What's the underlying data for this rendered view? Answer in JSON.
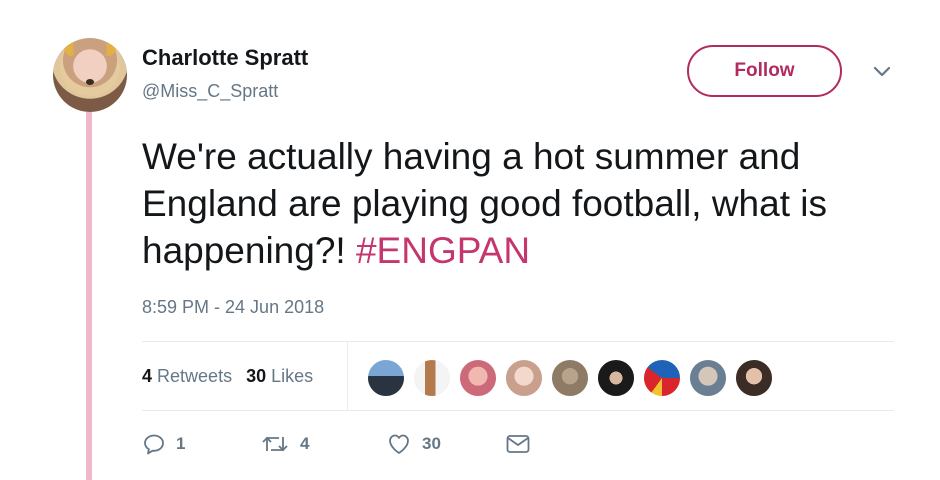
{
  "user": {
    "name": "Charlotte Spratt",
    "handle": "@Miss_C_Spratt"
  },
  "follow_label": "Follow",
  "tweet": {
    "text": "We're actually having a hot summer and England are playing good football, what is happening?! ",
    "hashtag": "#ENGPAN",
    "timestamp": "8:59 PM - 24 Jun 2018"
  },
  "stats": {
    "retweets_count": "4",
    "retweets_label": "Retweets",
    "likes_count": "30",
    "likes_label": "Likes"
  },
  "actions": {
    "reply_count": "1",
    "retweet_count": "4",
    "like_count": "30"
  },
  "colors": {
    "accent": "#b32a60",
    "hashtag": "#c5356e",
    "thread_line": "#efb9cb",
    "muted": "#657786"
  },
  "icons": [
    "reply-icon",
    "retweet-icon",
    "like-icon",
    "message-icon",
    "chevron-down-icon"
  ]
}
